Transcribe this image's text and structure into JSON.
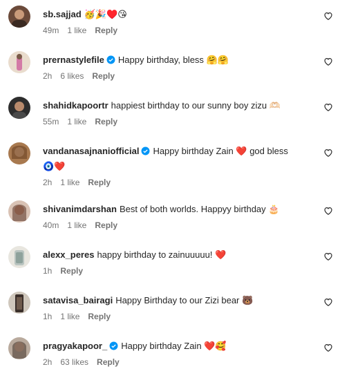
{
  "comments": [
    {
      "username": "sb.sajjad",
      "verified": false,
      "text": "🥳🎉♥️😘",
      "time": "49m",
      "likes": "1 like",
      "reply": "Reply"
    },
    {
      "username": "prernastylefile",
      "verified": true,
      "text": "Happy birthday, bless 🤗🤗",
      "time": "2h",
      "likes": "6 likes",
      "reply": "Reply"
    },
    {
      "username": "shahidkapoortr",
      "verified": false,
      "text": "happiest birthday to our sunny boy zizu 🫶🏻",
      "time": "55m",
      "likes": "1 like",
      "reply": "Reply"
    },
    {
      "username": "vandanasajnaniofficial",
      "verified": true,
      "text": "Happy birthday Zain ❤️ god bless",
      "text2": "🧿❤️",
      "time": "2h",
      "likes": "1 like",
      "reply": "Reply"
    },
    {
      "username": "shivanimdarshan",
      "verified": false,
      "text": "Best of both worlds. Happyy birthday 🎂",
      "time": "40m",
      "likes": "1 like",
      "reply": "Reply"
    },
    {
      "username": "alexx_peres",
      "verified": false,
      "text": "happy birthday to zainuuuuu! ❤️",
      "time": "1h",
      "likes": "",
      "reply": "Reply"
    },
    {
      "username": "satavisa_bairagi",
      "verified": false,
      "text": "Happy Birthday to our Zizi bear 🐻",
      "time": "1h",
      "likes": "1 like",
      "reply": "Reply"
    },
    {
      "username": "pragyakapoor_",
      "verified": true,
      "text": "Happy birthday Zain ❤️🥰",
      "time": "2h",
      "likes": "63 likes",
      "reply": "Reply"
    }
  ],
  "colors": {
    "text": "#262626",
    "meta": "#737373",
    "verified": "#0095f6"
  },
  "icons": {
    "like": "heart-outline-icon",
    "verified": "verified-badge-icon"
  }
}
